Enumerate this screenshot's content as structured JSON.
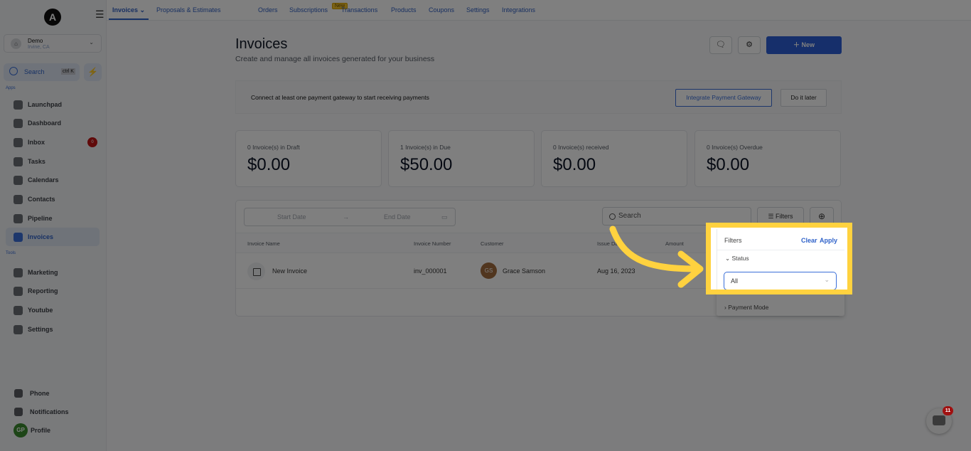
{
  "sidebar": {
    "logo_letter": "A",
    "account": {
      "name": "Demo",
      "location": "Irvine, CA"
    },
    "search": {
      "label": "Search",
      "shortcut": "ctrl K"
    },
    "apps_label": "Apps",
    "tools_label": "Tools",
    "apps": [
      {
        "label": "Launchpad",
        "icon": "rocket-icon"
      },
      {
        "label": "Dashboard",
        "icon": "grid-icon"
      },
      {
        "label": "Inbox",
        "icon": "inbox-icon",
        "badge": "0"
      },
      {
        "label": "Tasks",
        "icon": "clipboard-icon"
      },
      {
        "label": "Calendars",
        "icon": "calendar-icon"
      },
      {
        "label": "Contacts",
        "icon": "person-icon"
      },
      {
        "label": "Pipeline",
        "icon": "filter-icon"
      },
      {
        "label": "Invoices",
        "icon": "invoice-icon",
        "active": true
      }
    ],
    "tools": [
      {
        "label": "Marketing",
        "icon": "megaphone-icon"
      },
      {
        "label": "Reporting",
        "icon": "pie-chart-icon"
      },
      {
        "label": "Youtube",
        "icon": "youtube-icon"
      },
      {
        "label": "Settings",
        "icon": "gear-icon"
      }
    ],
    "bottom": [
      {
        "label": "Phone",
        "icon": "phone-icon"
      },
      {
        "label": "Notifications",
        "icon": "bell-icon"
      },
      {
        "label": "Profile",
        "initials": "GP"
      }
    ]
  },
  "topnav": {
    "tabs": [
      "Invoices",
      "Proposals & Estimates",
      "Orders",
      "Subscriptions",
      "Transactions",
      "Products",
      "Coupons",
      "Settings",
      "Integrations"
    ],
    "new_badge": "New"
  },
  "header": {
    "title": "Invoices",
    "subtitle": "Create and manage all invoices generated for your business",
    "new_button": "New"
  },
  "banner": {
    "text": "Connect at least one payment gateway to start receiving payments",
    "integrate": "Integrate Payment Gateway",
    "later": "Do it later"
  },
  "stats": [
    {
      "label": "0 Invoice(s) in Draft",
      "value": "$0.00"
    },
    {
      "label": "1 Invoice(s) in Due",
      "value": "$50.00"
    },
    {
      "label": "0 Invoice(s) received",
      "value": "$0.00"
    },
    {
      "label": "0 Invoice(s) Overdue",
      "value": "$0.00"
    }
  ],
  "table": {
    "start_date_placeholder": "Start Date",
    "end_date_placeholder": "End Date",
    "search_placeholder": "Search",
    "filters_label": "Filters",
    "columns": [
      "Invoice Name",
      "Invoice Number",
      "Customer",
      "Issue Date",
      "Amount"
    ],
    "rows": [
      {
        "name": "New Invoice",
        "number": "inv_000001",
        "customer_initials": "GS",
        "customer": "Grace Samson",
        "issue_date": "Aug 16, 2023"
      }
    ]
  },
  "filters_panel": {
    "title": "Filters",
    "clear": "Clear",
    "apply": "Apply",
    "status_label": "Status",
    "status_value": "All",
    "payment_mode_label": "Payment Mode"
  },
  "chat": {
    "badge": "11"
  },
  "colors": {
    "accent": "#2c5fd6",
    "highlight": "#ffd23f",
    "badge": "#c01515"
  }
}
